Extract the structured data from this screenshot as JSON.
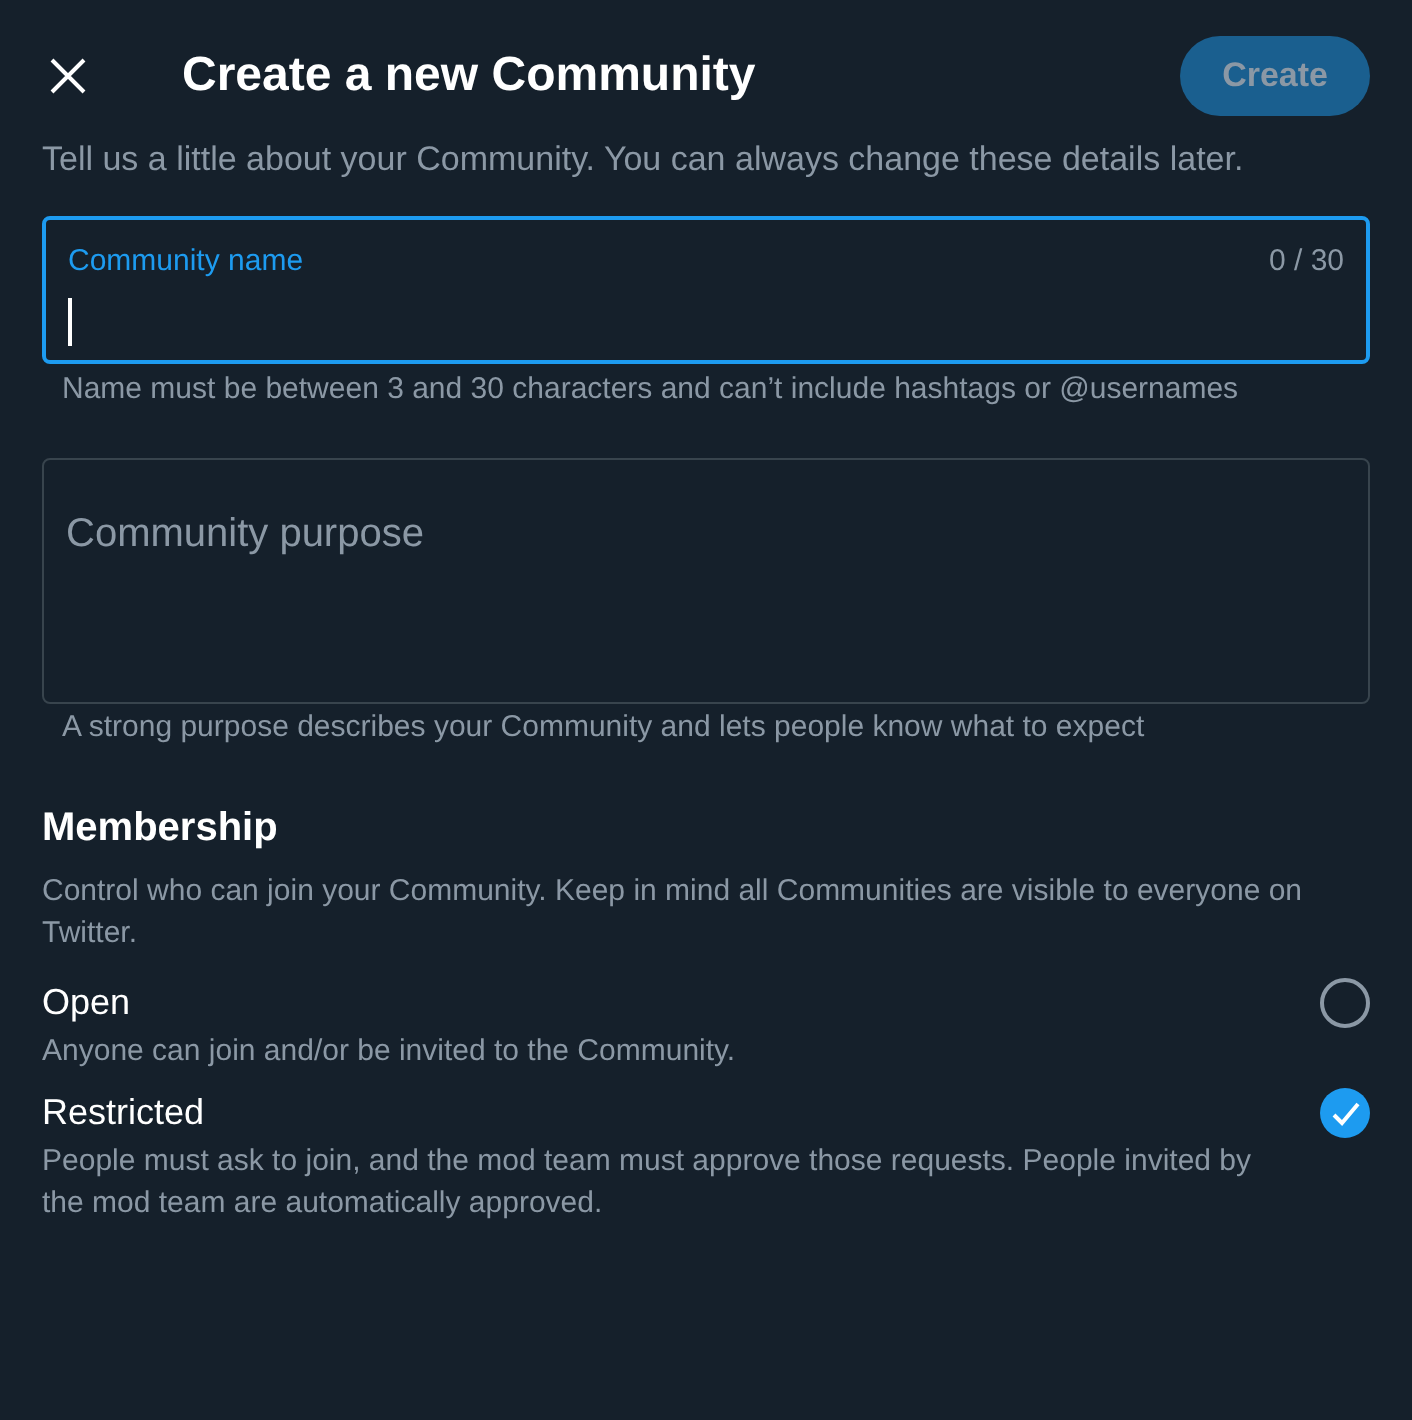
{
  "header": {
    "title": "Create a new Community",
    "create_button": {
      "label": "Create",
      "disabled": true
    }
  },
  "intro": "Tell us a little about your Community. You can always change these details later.",
  "name_field": {
    "label": "Community name",
    "counter": "0 / 30",
    "focused": true,
    "hint": "Name must be between 3 and 30 characters and can’t include hashtags or @usernames"
  },
  "purpose_field": {
    "placeholder": "Community purpose",
    "focused": false,
    "hint": "A strong purpose describes your Community and lets people know what to expect"
  },
  "membership": {
    "title": "Membership",
    "description": "Control who can join your Community. Keep in mind all Communities are visible to everyone on Twitter.",
    "options": [
      {
        "label": "Open",
        "description": "Anyone can join and/or be invited to the Community.",
        "selected": false
      },
      {
        "label": "Restricted",
        "description": "People must ask to join, and the mod team must approve those requests. People invited by the mod team are automatically approved.",
        "selected": true
      }
    ]
  }
}
